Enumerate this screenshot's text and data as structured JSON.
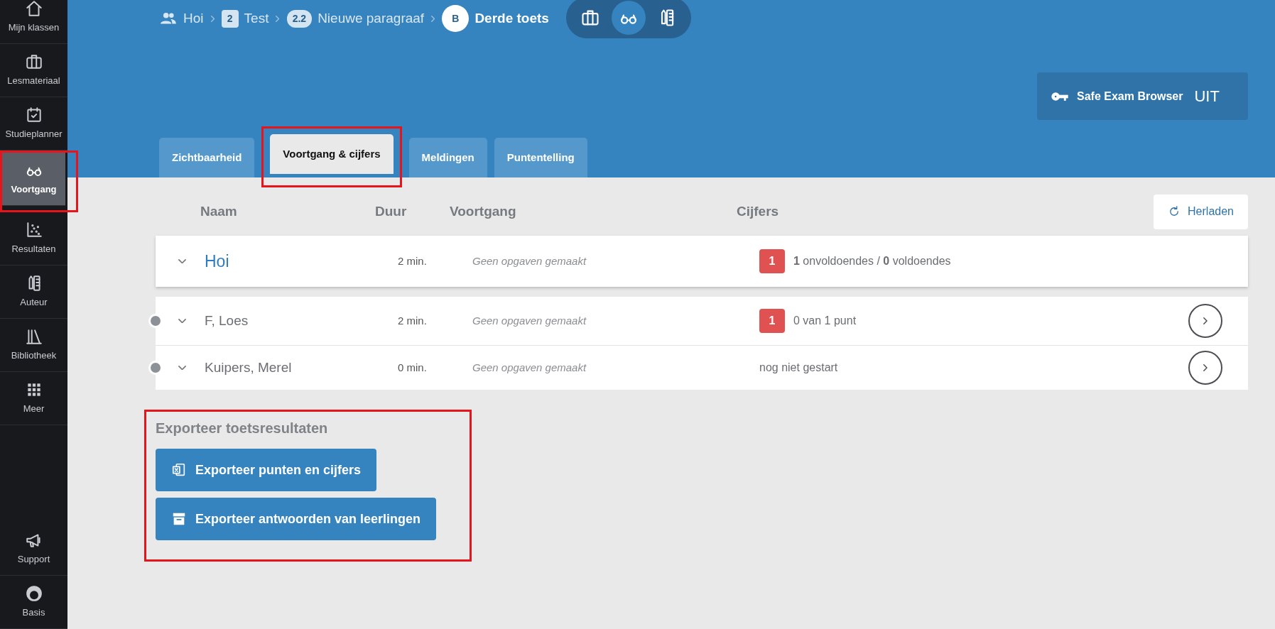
{
  "sidebar": {
    "items": [
      {
        "label": "Mijn klassen",
        "selected": false,
        "highlighted": false
      },
      {
        "label": "Lesmateriaal",
        "selected": false,
        "highlighted": false
      },
      {
        "label": "Studieplanner",
        "selected": false,
        "highlighted": false
      },
      {
        "label": "Voortgang",
        "selected": true,
        "highlighted": true
      },
      {
        "label": "Resultaten",
        "selected": false,
        "highlighted": false
      },
      {
        "label": "Auteur",
        "selected": false,
        "highlighted": false
      },
      {
        "label": "Bibliotheek",
        "selected": false,
        "highlighted": false
      },
      {
        "label": "Meer",
        "selected": false,
        "highlighted": false
      }
    ],
    "bottom_items": [
      {
        "label": "Support",
        "selected": false,
        "highlighted": false
      },
      {
        "label": "Basis",
        "selected": false,
        "highlighted": false
      }
    ]
  },
  "breadcrumb": [
    {
      "kind": "group",
      "label": "Hoi"
    },
    {
      "kind": "badge",
      "badge": "2",
      "label": "Test"
    },
    {
      "kind": "pill",
      "badge": "2.2",
      "label": "Nieuwe paragraaf"
    },
    {
      "kind": "circle",
      "badge": "B",
      "label": "Derde toets"
    }
  ],
  "mode_switch": [
    {
      "selected": false
    },
    {
      "selected": true
    },
    {
      "selected": false
    }
  ],
  "safe_exam_browser": {
    "label": "Safe Exam Browser",
    "value": "UIT"
  },
  "tabs": [
    {
      "label": "Zichtbaarheid",
      "selected": false,
      "highlighted": false
    },
    {
      "label": "Voortgang & cijfers",
      "selected": true,
      "highlighted": true
    },
    {
      "label": "Meldingen",
      "selected": false,
      "highlighted": false
    },
    {
      "label": "Puntentelling",
      "selected": false,
      "highlighted": false
    }
  ],
  "reload_button": "Herladen",
  "table": {
    "columns": [
      "Naam",
      "Duur",
      "Voortgang",
      "Cijfers"
    ],
    "group_row": {
      "name": "Hoi",
      "duration": "2 min.",
      "progress": "Geen opgaven gemaakt",
      "grade_badge": "1",
      "grade_text": "**1** onvoldoendes / **0** voldoendes"
    },
    "rows": [
      {
        "name": "F, Loes",
        "duration": "2 min.",
        "progress": "Geen opgaven gemaakt",
        "grade_badge": "1",
        "grade_text": "0 van 1 punt"
      },
      {
        "name": "Kuipers, Merel",
        "duration": "0 min.",
        "progress": "Geen opgaven gemaakt",
        "grade_text": "nog niet gestart"
      }
    ]
  },
  "export": {
    "title": "Exporteer toetsresultaten",
    "highlighted": true,
    "buttons": [
      {
        "label": "Exporteer punten en cijfers"
      },
      {
        "label": "Exporteer antwoorden van leerlingen"
      }
    ]
  }
}
